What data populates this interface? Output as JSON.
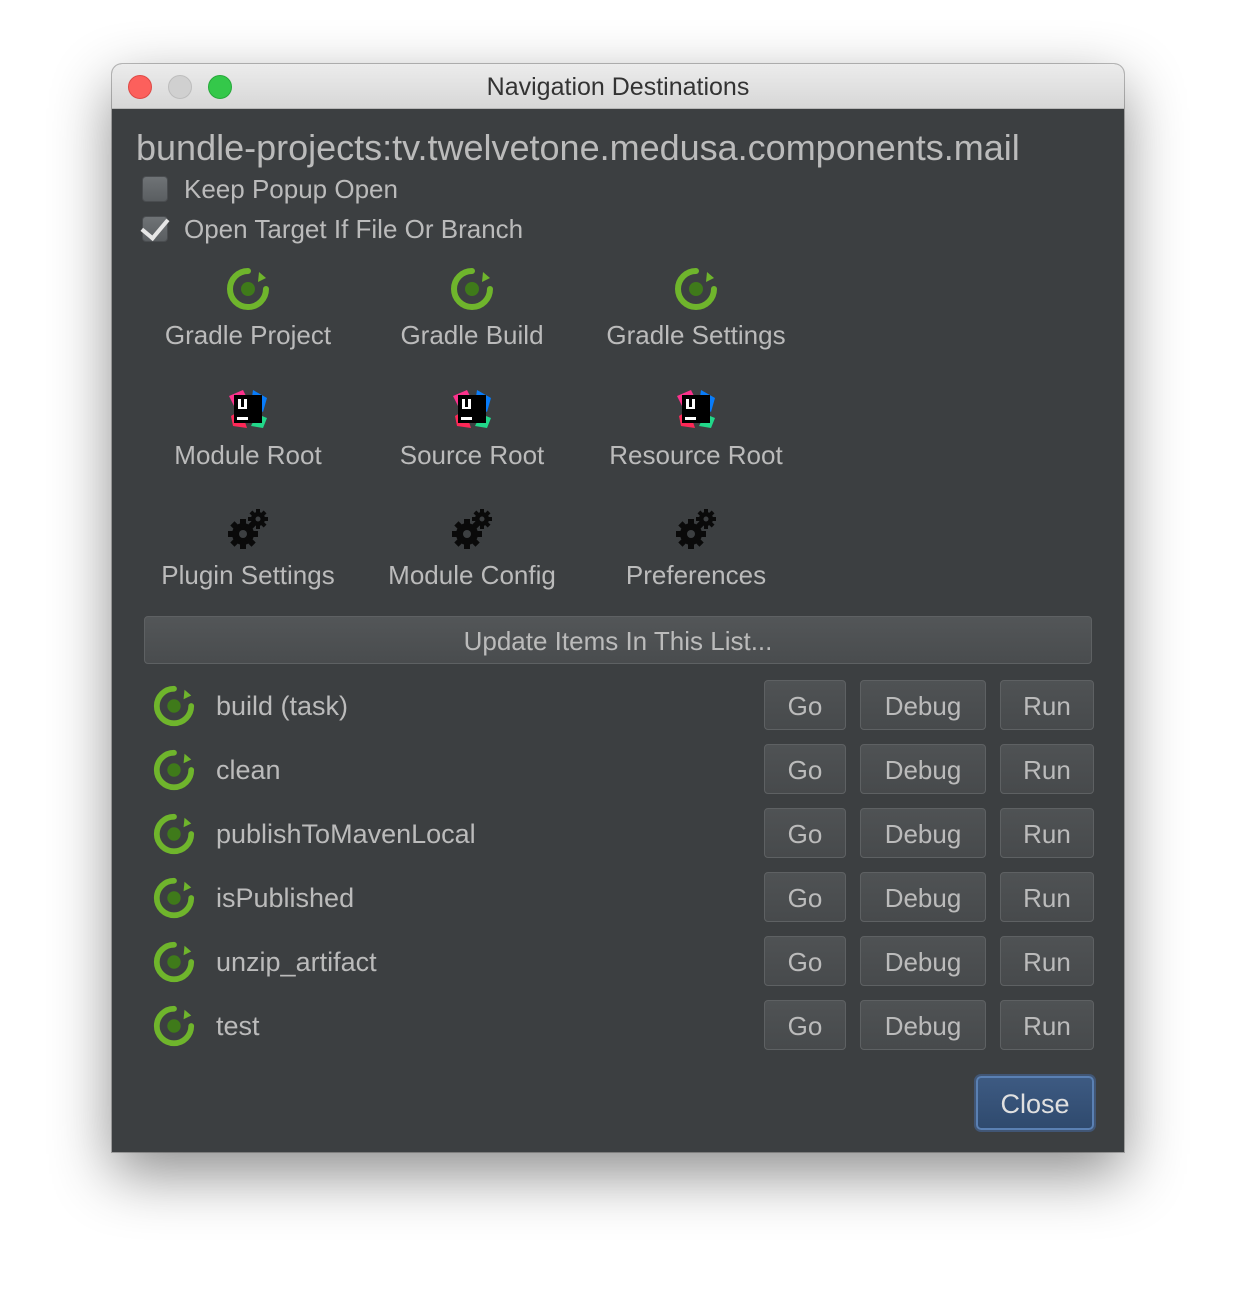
{
  "window": {
    "title": "Navigation Destinations"
  },
  "project_label": "bundle-projects:tv.twelvetone.medusa.components.mail",
  "options": [
    {
      "label": "Keep Popup Open",
      "checked": false
    },
    {
      "label": "Open Target If File Or Branch",
      "checked": true
    }
  ],
  "destinations": [
    {
      "label": "Gradle Project",
      "icon": "gradle-icon"
    },
    {
      "label": "Gradle Build",
      "icon": "gradle-icon"
    },
    {
      "label": "Gradle Settings",
      "icon": "gradle-icon"
    },
    {
      "label": "Module Root",
      "icon": "intellij-icon"
    },
    {
      "label": "Source Root",
      "icon": "intellij-icon"
    },
    {
      "label": "Resource Root",
      "icon": "intellij-icon"
    },
    {
      "label": "Plugin Settings",
      "icon": "gear-icon"
    },
    {
      "label": "Module Config",
      "icon": "gear-icon"
    },
    {
      "label": "Preferences",
      "icon": "gear-icon"
    }
  ],
  "update_button": "Update Items In This List...",
  "tasks": [
    {
      "name": "build (task)",
      "icon": "gradle-icon"
    },
    {
      "name": "clean",
      "icon": "gradle-icon"
    },
    {
      "name": "publishToMavenLocal",
      "icon": "gradle-icon"
    },
    {
      "name": "isPublished",
      "icon": "gradle-icon"
    },
    {
      "name": "unzip_artifact",
      "icon": "gradle-icon"
    },
    {
      "name": "test",
      "icon": "gradle-icon"
    }
  ],
  "task_buttons": {
    "go": "Go",
    "debug": "Debug",
    "run": "Run"
  },
  "close_button": "Close",
  "colors": {
    "background": "#3c3f41",
    "text": "#bbbbbb",
    "gradle_green": "#6fb52c",
    "close_accent": "#3d5a82"
  }
}
